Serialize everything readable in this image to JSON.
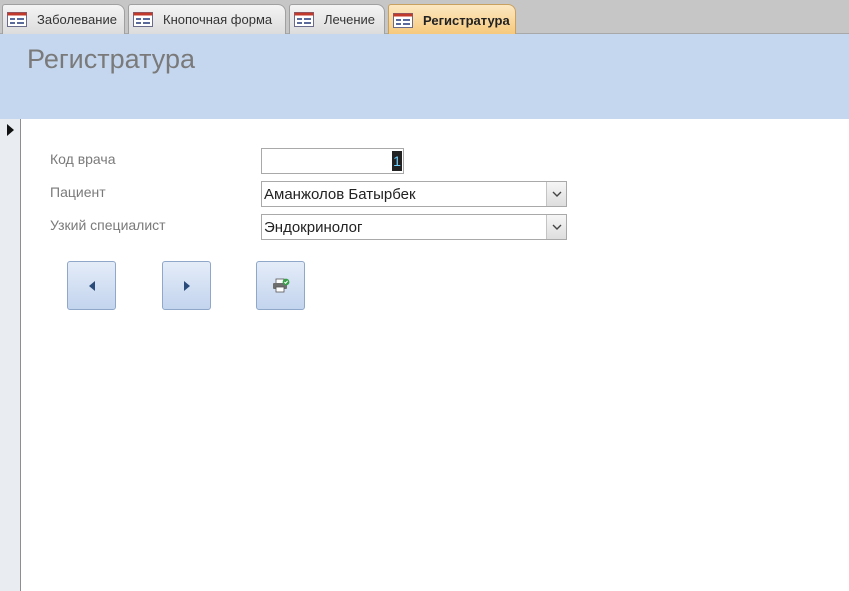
{
  "tabs": [
    {
      "label": "Заболевание",
      "icon": "form-icon",
      "active": false
    },
    {
      "label": "Кнопочная форма",
      "icon": "form-icon",
      "active": false
    },
    {
      "label": "Лечение",
      "icon": "form-icon",
      "active": false
    },
    {
      "label": "Регистратура",
      "icon": "form-icon",
      "active": true
    }
  ],
  "form": {
    "title": "Регистратура",
    "fields": {
      "doctor_code": {
        "label": "Код врача",
        "value": "1"
      },
      "patient": {
        "label": "Пациент",
        "value": "Аманжолов Батырбек"
      },
      "specialist": {
        "label": "Узкий специалист",
        "value": "Эндокринолог"
      }
    }
  },
  "buttons": [
    {
      "name": "previous-record-button",
      "icon": "arrow-left-icon"
    },
    {
      "name": "next-record-button",
      "icon": "arrow-right-icon"
    },
    {
      "name": "print-record-button",
      "icon": "printer-icon"
    }
  ],
  "colors": {
    "header_bg": "#c5d7ef",
    "active_tab": "#f6c87a",
    "title_text": "#7a7a7a"
  }
}
